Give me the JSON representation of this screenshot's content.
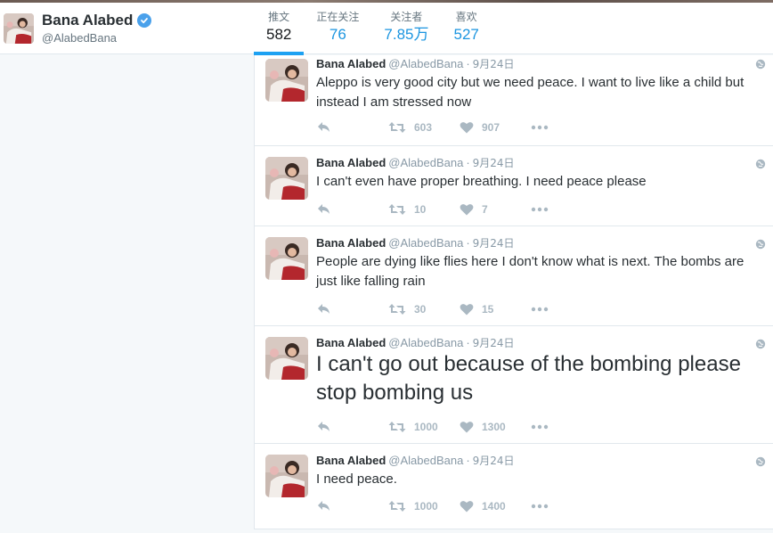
{
  "profile": {
    "name": "Bana Alabed",
    "handle": "@AlabedBana"
  },
  "stats": [
    {
      "label": "推文",
      "value": "582",
      "active": true
    },
    {
      "label": "正在关注",
      "value": "76",
      "active": false
    },
    {
      "label": "关注者",
      "value": "7.85万",
      "active": false
    },
    {
      "label": "喜欢",
      "value": "527",
      "active": false
    }
  ],
  "tweets": [
    {
      "name": "Bana Alabed",
      "handle": "@AlabedBana",
      "date": "9月24日",
      "text": "Aleppo is very good city but we need peace. I want to live like a child but instead I am stressed now",
      "retweets": "603",
      "likes": "907"
    },
    {
      "name": "Bana Alabed",
      "handle": "@AlabedBana",
      "date": "9月24日",
      "text": "I can't even have proper breathing. I need peace please",
      "retweets": "10",
      "likes": "7"
    },
    {
      "name": "Bana Alabed",
      "handle": "@AlabedBana",
      "date": "9月24日",
      "text": "People are dying like flies here I don't know what is next. The bombs are just like falling rain",
      "retweets": "30",
      "likes": "15"
    },
    {
      "name": "Bana Alabed",
      "handle": "@AlabedBana",
      "date": "9月24日",
      "text": "I can't go out because of the bombing please stop bombing us",
      "retweets": "1000",
      "likes": "1300"
    },
    {
      "name": "Bana Alabed",
      "handle": "@AlabedBana",
      "date": "9月24日",
      "text": "I need peace.",
      "retweets": "1000",
      "likes": "1400"
    }
  ],
  "icons": {
    "verified": "verified-badge-icon",
    "reply": "reply-icon",
    "retweet": "retweet-icon",
    "like": "heart-icon",
    "more": "more-dots-icon",
    "globe": "globe-icon"
  },
  "colors": {
    "accent": "#1da1f2",
    "stat_value": "#1b95e0",
    "action_gray": "#aab8c2"
  }
}
